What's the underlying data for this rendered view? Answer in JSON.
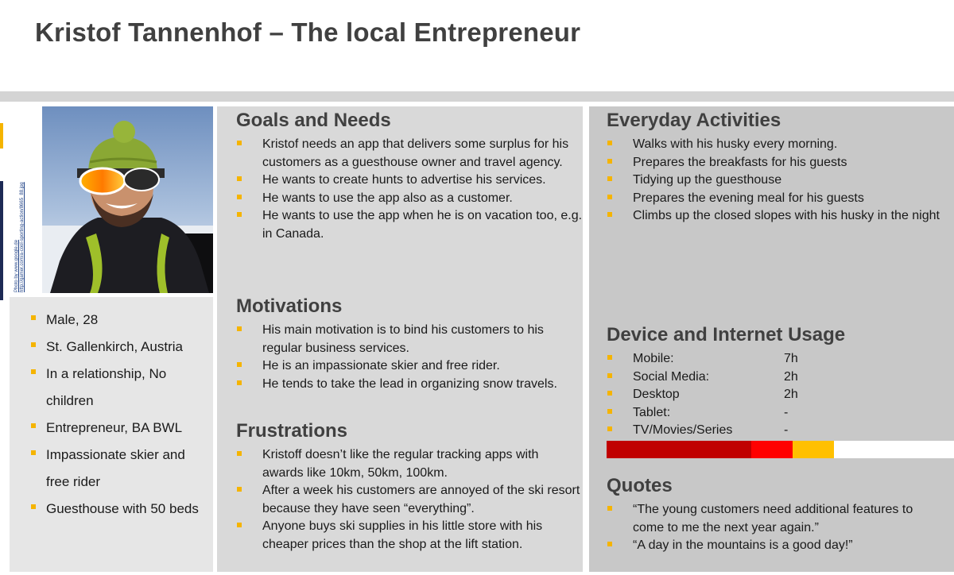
{
  "title": "Kristof Tannenhof – The local Entrepreneur",
  "photo_credit": "Photo by www.google.de\nhttp://gamer.com/a-cool-sporting-action/8665_88.jpg",
  "colors": {
    "bullet": "#f5b400",
    "heading": "#404040"
  },
  "demographics": [
    "Male, 28",
    "St. Gallenkirch, Austria",
    "In a relationship, No children",
    "Entrepreneur, BA BWL",
    "Impassionate skier and free rider",
    "Guesthouse with 50 beds"
  ],
  "goals": {
    "heading": "Goals and Needs",
    "items": [
      "Kristof needs an app that delivers some surplus for his customers as a guesthouse owner and travel agency.",
      "He wants to create hunts to advertise his services.",
      "He wants to use the app also as a customer.",
      "He wants to use the app when he is on vacation too, e.g. in Canada."
    ]
  },
  "motivations": {
    "heading": "Motivations",
    "items": [
      "His main motivation is to bind his customers to his regular business services.",
      "He is an impassionate skier and free rider.",
      "He tends to take the lead in organizing snow travels."
    ]
  },
  "frustrations": {
    "heading": "Frustrations",
    "items": [
      "Kristoff doesn’t like the regular tracking apps with awards like 10km, 50km, 100km.",
      "After a week his customers are annoyed of the ski resort because they have seen “everything”.",
      "Anyone buys ski supplies in his little store with his cheaper prices than the shop at the lift station."
    ]
  },
  "everyday": {
    "heading": "Everyday Activities",
    "items": [
      "Walks with his husky every morning.",
      "Prepares the breakfasts for his guests",
      "Tidying up the guesthouse",
      "Prepares the evening meal for his guests",
      "Climbs up the closed slopes with his husky in the night"
    ]
  },
  "device_usage": {
    "heading": "Device and Internet Usage",
    "rows": [
      {
        "label": "Mobile:",
        "value": "7h"
      },
      {
        "label": "Social Media:",
        "value": "2h"
      },
      {
        "label": "Desktop",
        "value": "2h"
      },
      {
        "label": "Tablet:",
        "value": "-"
      },
      {
        "label": "TV/Movies/Series",
        "value": "-"
      }
    ],
    "bar_segments": [
      {
        "name": "Mobile",
        "share": 0.4167,
        "color": "#c00000"
      },
      {
        "name": "Social Media",
        "share": 0.1191,
        "color": "#ff0000"
      },
      {
        "name": "Desktop",
        "share": 0.1191,
        "color": "#ffc000"
      },
      {
        "name": "Remaining",
        "share": 0.3451,
        "color": "#ffffff"
      }
    ]
  },
  "quotes": {
    "heading": "Quotes",
    "items": [
      "“The young customers need additional features to come to me the next year again.”",
      "“A day in the mountains is a good day!”"
    ]
  }
}
